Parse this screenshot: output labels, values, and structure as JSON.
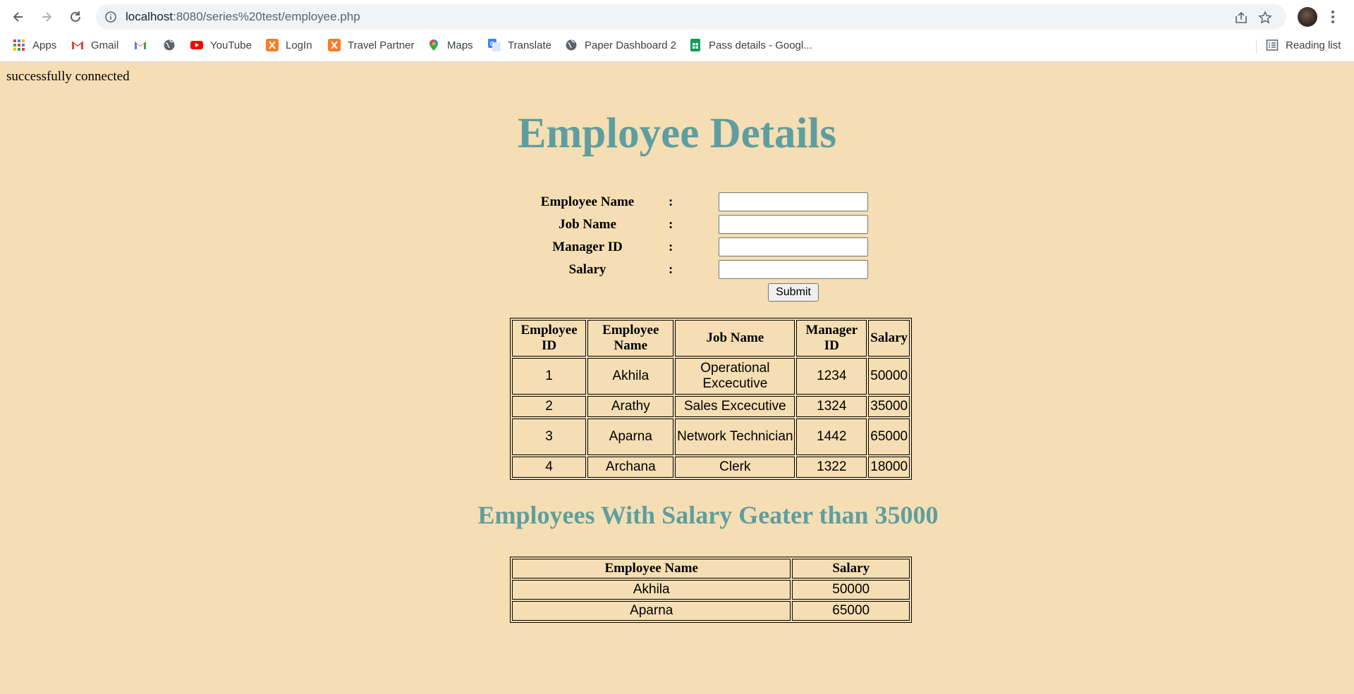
{
  "browser": {
    "url_host": "localhost",
    "url_rest": ":8080/series%20test/employee.php",
    "bookmarks": [
      {
        "label": "Apps",
        "icon": "apps-grid-icon"
      },
      {
        "label": "Gmail",
        "icon": "gmail-icon"
      },
      {
        "label": "",
        "icon": "gmail-icon"
      },
      {
        "label": "",
        "icon": "globe-icon"
      },
      {
        "label": "YouTube",
        "icon": "youtube-icon"
      },
      {
        "label": "LogIn",
        "icon": "xampp-icon"
      },
      {
        "label": "Travel Partner",
        "icon": "xampp-icon"
      },
      {
        "label": "Maps",
        "icon": "maps-pin-icon"
      },
      {
        "label": "Translate",
        "icon": "translate-icon"
      },
      {
        "label": "Paper Dashboard 2",
        "icon": "globe-icon"
      },
      {
        "label": "Pass details - Googl...",
        "icon": "sheets-icon"
      }
    ],
    "reading_list": "Reading list"
  },
  "page": {
    "status": "successfully connected",
    "title": "Employee Details",
    "form": {
      "fields": [
        {
          "label": "Employee Name",
          "colon": ":",
          "value": ""
        },
        {
          "label": "Job Name",
          "colon": ":",
          "value": ""
        },
        {
          "label": "Manager ID",
          "colon": ":",
          "value": ""
        },
        {
          "label": "Salary",
          "colon": ":",
          "value": ""
        }
      ],
      "submit": "Submit"
    },
    "employees": {
      "headers": [
        "Employee ID",
        "Employee Name",
        "Job Name",
        "Manager ID",
        "Salary"
      ],
      "rows": [
        [
          "1",
          "Akhila",
          "Operational Excecutive",
          "1234",
          "50000"
        ],
        [
          "2",
          "Arathy",
          "Sales Excecutive",
          "1324",
          "35000"
        ],
        [
          "3",
          "Aparna",
          "Network Technician",
          "1442",
          "65000"
        ],
        [
          "4",
          "Archana",
          "Clerk",
          "1322",
          "18000"
        ]
      ]
    },
    "filter_title": "Employees With Salary Geater than 35000",
    "filtered": {
      "headers": [
        "Employee Name",
        "Salary"
      ],
      "rows": [
        [
          "Akhila",
          "50000"
        ],
        [
          "Aparna",
          "65000"
        ]
      ]
    }
  }
}
